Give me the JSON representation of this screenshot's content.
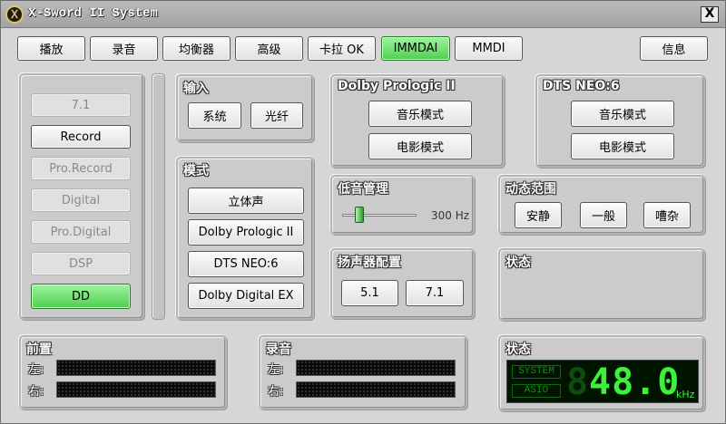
{
  "window": {
    "title": "X-Sword II System",
    "logo_letter": "Ⅹ",
    "close_label": "X"
  },
  "toolbar": {
    "tabs": [
      "播放",
      "录音",
      "均衡器",
      "高级",
      "卡拉 OK",
      "IMMDAI",
      "MMDI"
    ],
    "active_tab": "IMMDAI",
    "info_label": "信息"
  },
  "left_list": {
    "items": [
      "7.1",
      "Record",
      "Pro.Record",
      "Digital",
      "Pro.Digital",
      "DSP",
      "DD"
    ],
    "active": "DD"
  },
  "input": {
    "title": "输入",
    "buttons": [
      "系统",
      "光纤"
    ]
  },
  "mode": {
    "title": "模式",
    "buttons": [
      "立体声",
      "Dolby Prologic II",
      "DTS NEO:6",
      "Dolby Digital EX"
    ]
  },
  "dolby": {
    "title": "Dolby Prologic II",
    "buttons": [
      "音乐模式",
      "电影模式"
    ]
  },
  "dts": {
    "title": "DTS NEO:6",
    "buttons": [
      "音乐模式",
      "电影模式"
    ]
  },
  "bass": {
    "title": "低音管理",
    "value_label": "300 Hz",
    "slider_fraction": 0.2
  },
  "dynamic": {
    "title": "动态范围",
    "buttons": [
      "安静",
      "一般",
      "嘈杂"
    ]
  },
  "speaker": {
    "title": "扬声器配置",
    "buttons": [
      "5.1",
      "7.1"
    ]
  },
  "status_mid": {
    "title": "状态"
  },
  "front": {
    "title": "前置",
    "left": "左:",
    "right": "右:"
  },
  "record": {
    "title": "录音",
    "left": "左:",
    "right": "右:"
  },
  "status": {
    "title": "状态",
    "system_tag": "SYSTEM",
    "asio_tag": "ASIO",
    "rate": "48.0",
    "rate_dim": "8",
    "unit": "kHz"
  },
  "colors": {
    "active": "#4fcf4f",
    "lcd_bg": "#001400",
    "lcd_text": "#3cf03c"
  }
}
